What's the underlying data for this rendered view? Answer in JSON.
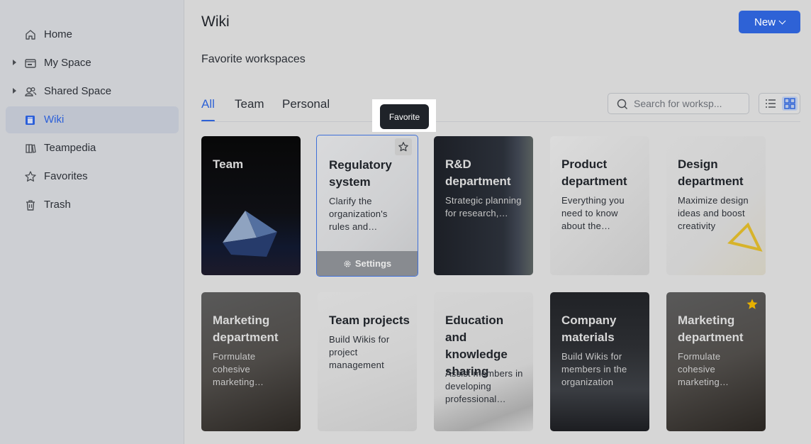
{
  "sidebar": {
    "items": [
      {
        "label": "Home",
        "icon": "home-icon"
      },
      {
        "label": "My Space",
        "icon": "folder-icon"
      },
      {
        "label": "Shared Space",
        "icon": "people-icon"
      },
      {
        "label": "Wiki",
        "icon": "wiki-icon"
      },
      {
        "label": "Teampedia",
        "icon": "books-icon"
      },
      {
        "label": "Favorites",
        "icon": "star-icon"
      },
      {
        "label": "Trash",
        "icon": "trash-icon"
      }
    ]
  },
  "header": {
    "title": "Wiki",
    "new_label": "New",
    "section_title": "Favorite workspaces"
  },
  "tabs": [
    {
      "label": "All"
    },
    {
      "label": "Team"
    },
    {
      "label": "Personal"
    }
  ],
  "search": {
    "placeholder": "Search for worksp..."
  },
  "tooltip": "Favorite",
  "cards": [
    {
      "title": "Team",
      "desc": ""
    },
    {
      "title": "Regulatory system",
      "desc": "Clarify the organization's rules and…",
      "action": "Settings"
    },
    {
      "title": "R&D department",
      "desc": "Strategic planning for research,…"
    },
    {
      "title": "Product department",
      "desc": "Everything you need to know about the…"
    },
    {
      "title": "Design department",
      "desc": "Maximize design ideas and boost creativity"
    },
    {
      "title": "Marketing department",
      "desc": "Formulate cohesive marketing…"
    },
    {
      "title": "Team projects",
      "desc": "Build Wikis for project management"
    },
    {
      "title": "Education and knowledge sharing",
      "desc": "Assist members in developing professional…"
    },
    {
      "title": "Company materials",
      "desc": "Build Wikis for members in the organization"
    },
    {
      "title": "Marketing department",
      "desc": "Formulate cohesive marketing…",
      "favorited": true
    }
  ],
  "colors": {
    "accent": "#2e62d6",
    "star": "#e6b000"
  }
}
